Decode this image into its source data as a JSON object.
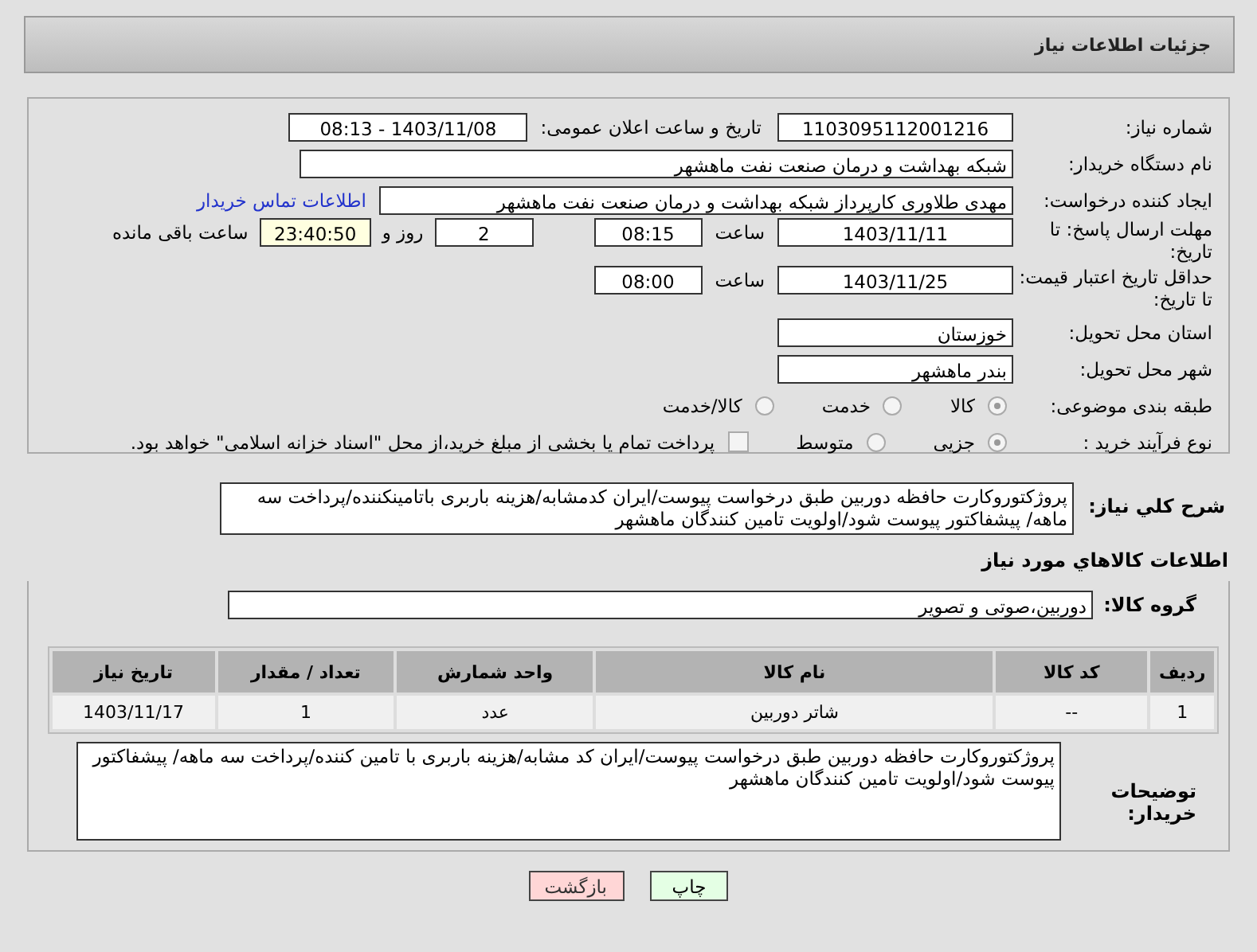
{
  "header": {
    "title": "جزئیات اطلاعات نیاز"
  },
  "need_number": {
    "label": "شماره نیاز:",
    "value": "1103095112001216"
  },
  "announce": {
    "label": "تاریخ و ساعت اعلان عمومی:",
    "value": "1403/11/08 - 08:13"
  },
  "buyer_org": {
    "label": "نام دستگاه خریدار:",
    "value": "شبکه بهداشت و درمان صنعت نفت ماهشهر"
  },
  "requester": {
    "label": "ایجاد کننده درخواست:",
    "value": "مهدی طلاوری کارپرداز شبکه بهداشت و درمان صنعت نفت ماهشهر",
    "link": "اطلاعات تماس خریدار"
  },
  "reply_deadline": {
    "label": "مهلت ارسال پاسخ: تا تاریخ:",
    "date": "1403/11/11",
    "time_label": "ساعت",
    "time": "08:15",
    "days": "2",
    "days_label": "روز و",
    "remaining": "23:40:50",
    "remaining_label": "ساعت باقی مانده"
  },
  "price_validity": {
    "label": "حداقل تاریخ اعتبار قیمت: تا تاریخ:",
    "date": "1403/11/25",
    "time_label": "ساعت",
    "time": "08:00"
  },
  "province": {
    "label": "استان محل تحویل:",
    "value": "خوزستان"
  },
  "city": {
    "label": "شهر محل تحویل:",
    "value": "بندر ماهشهر"
  },
  "category": {
    "label": "طبقه بندی موضوعی:",
    "options": [
      {
        "label": "کالا",
        "selected": true
      },
      {
        "label": "خدمت",
        "selected": false
      },
      {
        "label": "کالا/خدمت",
        "selected": false
      }
    ]
  },
  "process": {
    "label": "نوع فرآیند خرید :",
    "options": [
      {
        "label": "جزیی",
        "selected": true
      },
      {
        "label": "متوسط",
        "selected": false
      }
    ],
    "payment": {
      "label": "پرداخت تمام یا بخشی از مبلغ خرید،از محل \"اسناد خزانه اسلامی\" خواهد بود.",
      "checked": false
    }
  },
  "description": {
    "label": "شرح کلي نياز:",
    "value": "پروژکتوروکارت حافظه دوربین طبق درخواست پیوست/ایران کدمشابه/هزینه باربری باتامینکننده/پرداخت سه ماهه/ پیشفاکتور پیوست شود/اولویت تامین کنندگان ماهشهر"
  },
  "goods_title": "اطلاعات كالاهاي مورد نياز",
  "goods_group": {
    "label": "گروه کالا:",
    "value": "دوربین،صوتی و تصویر"
  },
  "table": {
    "columns": [
      "ردیف",
      "کد کالا",
      "نام کالا",
      "واحد شمارش",
      "تعداد / مقدار",
      "تاریخ نیاز"
    ],
    "rows": [
      [
        "1",
        "--",
        "شاتر دوربین",
        "عدد",
        "1",
        "1403/11/17"
      ]
    ]
  },
  "buyer_notes": {
    "label": "توضیحات خریدار:",
    "value": "پروژکتوروکارت حافظه دوربین طبق درخواست پیوست/ایران کد مشابه/هزینه باربری با تامین کننده/پرداخت سه ماهه/ پیشفاکتور پیوست شود/اولویت تامین کنندگان ماهشهر"
  },
  "buttons": [
    {
      "kind": "print",
      "label": "چاپ"
    },
    {
      "kind": "back",
      "label": "بازگشت"
    }
  ]
}
